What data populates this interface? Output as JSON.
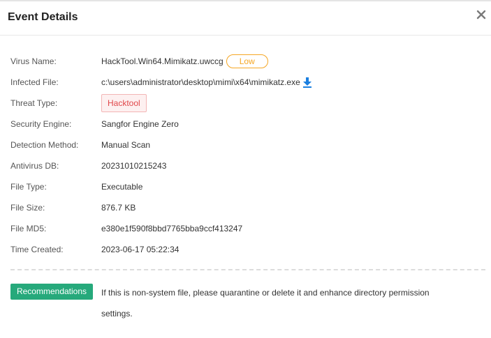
{
  "dialog": {
    "title": "Event Details",
    "close_icon": "close-icon"
  },
  "details": {
    "virus_name": {
      "label": "Virus Name:",
      "value": "HackTool.Win64.Mimikatz.uwccg",
      "level": "Low"
    },
    "infected_file": {
      "label": "Infected File:",
      "value": "c:\\users\\administrator\\desktop\\mimi\\x64\\mimikatz.exe",
      "icon": "download-icon"
    },
    "threat_type": {
      "label": "Threat Type:",
      "value": "Hacktool"
    },
    "security_engine": {
      "label": "Security Engine:",
      "value": "Sangfor Engine Zero"
    },
    "detection_method": {
      "label": "Detection Method:",
      "value": "Manual Scan"
    },
    "antivirus_db": {
      "label": "Antivirus DB:",
      "value": "20231010215243"
    },
    "file_type": {
      "label": "File Type:",
      "value": "Executable"
    },
    "file_size": {
      "label": "File Size:",
      "value": "876.7 KB"
    },
    "file_md5": {
      "label": "File MD5:",
      "value": "e380e1f590f8bbd7765bba9ccf413247"
    },
    "time_created": {
      "label": "Time Created:",
      "value": "2023-06-17 05:22:34"
    }
  },
  "recommendations": {
    "button_label": "Recommendations",
    "text": "If this is non-system file, please quarantine or delete it and enhance directory permission settings."
  },
  "colors": {
    "accent_green": "#26a97b",
    "low_level": "#f5a623",
    "threat_tag": "#e0474a",
    "download_icon": "#1a7fe0"
  }
}
